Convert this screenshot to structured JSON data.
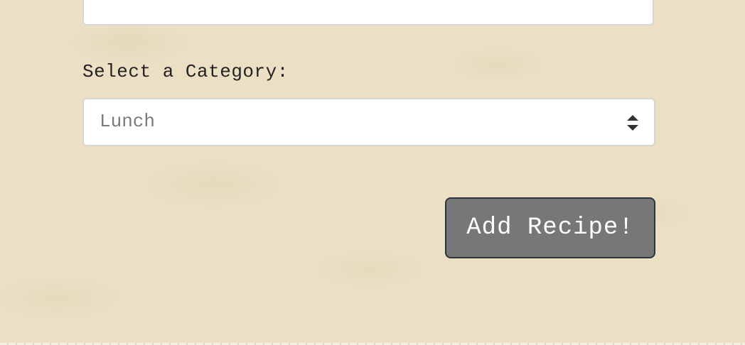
{
  "form": {
    "top_field_value": "",
    "category_label": "Select a Category:",
    "category_select": {
      "selected": "Lunch"
    },
    "submit_label": "Add Recipe!"
  },
  "colors": {
    "background": "#ebe0c4",
    "button": "#777777",
    "button_border": "#2d3440",
    "field_border": "#d6d6d6"
  }
}
